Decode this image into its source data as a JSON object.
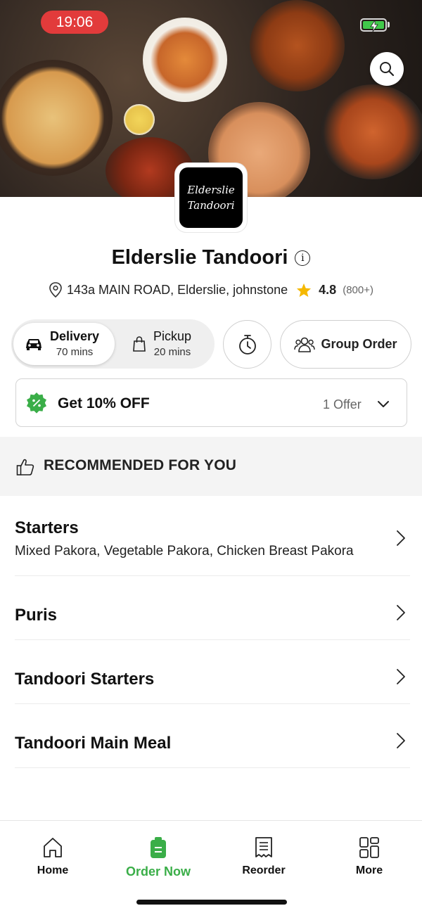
{
  "status_bar": {
    "time": "19:06"
  },
  "restaurant": {
    "logo_line1": "Elderslie",
    "logo_line2": "Tandoori",
    "name": "Elderslie Tandoori",
    "address": "143a MAIN ROAD, Elderslie, johnstone",
    "rating": "4.8",
    "reviews": "(800+)"
  },
  "order_mode": {
    "delivery": {
      "label": "Delivery",
      "time": "70 mins",
      "selected": true
    },
    "pickup": {
      "label": "Pickup",
      "time": "20 mins",
      "selected": false
    }
  },
  "group_order_label": "Group Order",
  "offer": {
    "title": "Get 10% OFF",
    "count": "1 Offer"
  },
  "recommended_title": "RECOMMENDED FOR YOU",
  "menu_sections": [
    {
      "name": "Starters",
      "description": "Mixed Pakora, Vegetable Pakora, Chicken Breast Pakora"
    },
    {
      "name": "Puris"
    },
    {
      "name": "Tandoori Starters"
    },
    {
      "name": "Tandoori Main Meal"
    }
  ],
  "bottom_nav": [
    {
      "label": "Home",
      "icon": "home-icon"
    },
    {
      "label": "Order Now",
      "icon": "order-bag-icon",
      "active": true
    },
    {
      "label": "Reorder",
      "icon": "receipt-icon"
    },
    {
      "label": "More",
      "icon": "grid-icon"
    }
  ],
  "colors": {
    "brand_green": "#3aae48",
    "status_red": "#e23b3b",
    "star": "#f5b800",
    "battery_green": "#41c94b"
  }
}
